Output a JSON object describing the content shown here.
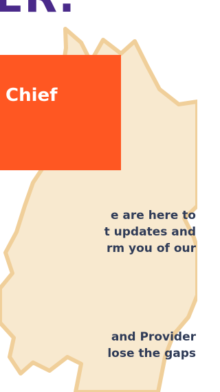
{
  "hero": {
    "heading_fragment": "ER."
  },
  "card": {
    "title": "Chief",
    "color": "#ff5722"
  },
  "paragraphs": [
    {
      "lines": [
        "e are here to",
        "t updates and",
        "rm you of our"
      ]
    },
    {
      "lines": [
        "and Provider",
        "lose the gaps"
      ]
    }
  ],
  "colors": {
    "heading": "#4a2a8a",
    "body_text": "#2f3b57",
    "leaf_fill": "#f8e9cf",
    "leaf_outline": "#f0cf9a"
  }
}
